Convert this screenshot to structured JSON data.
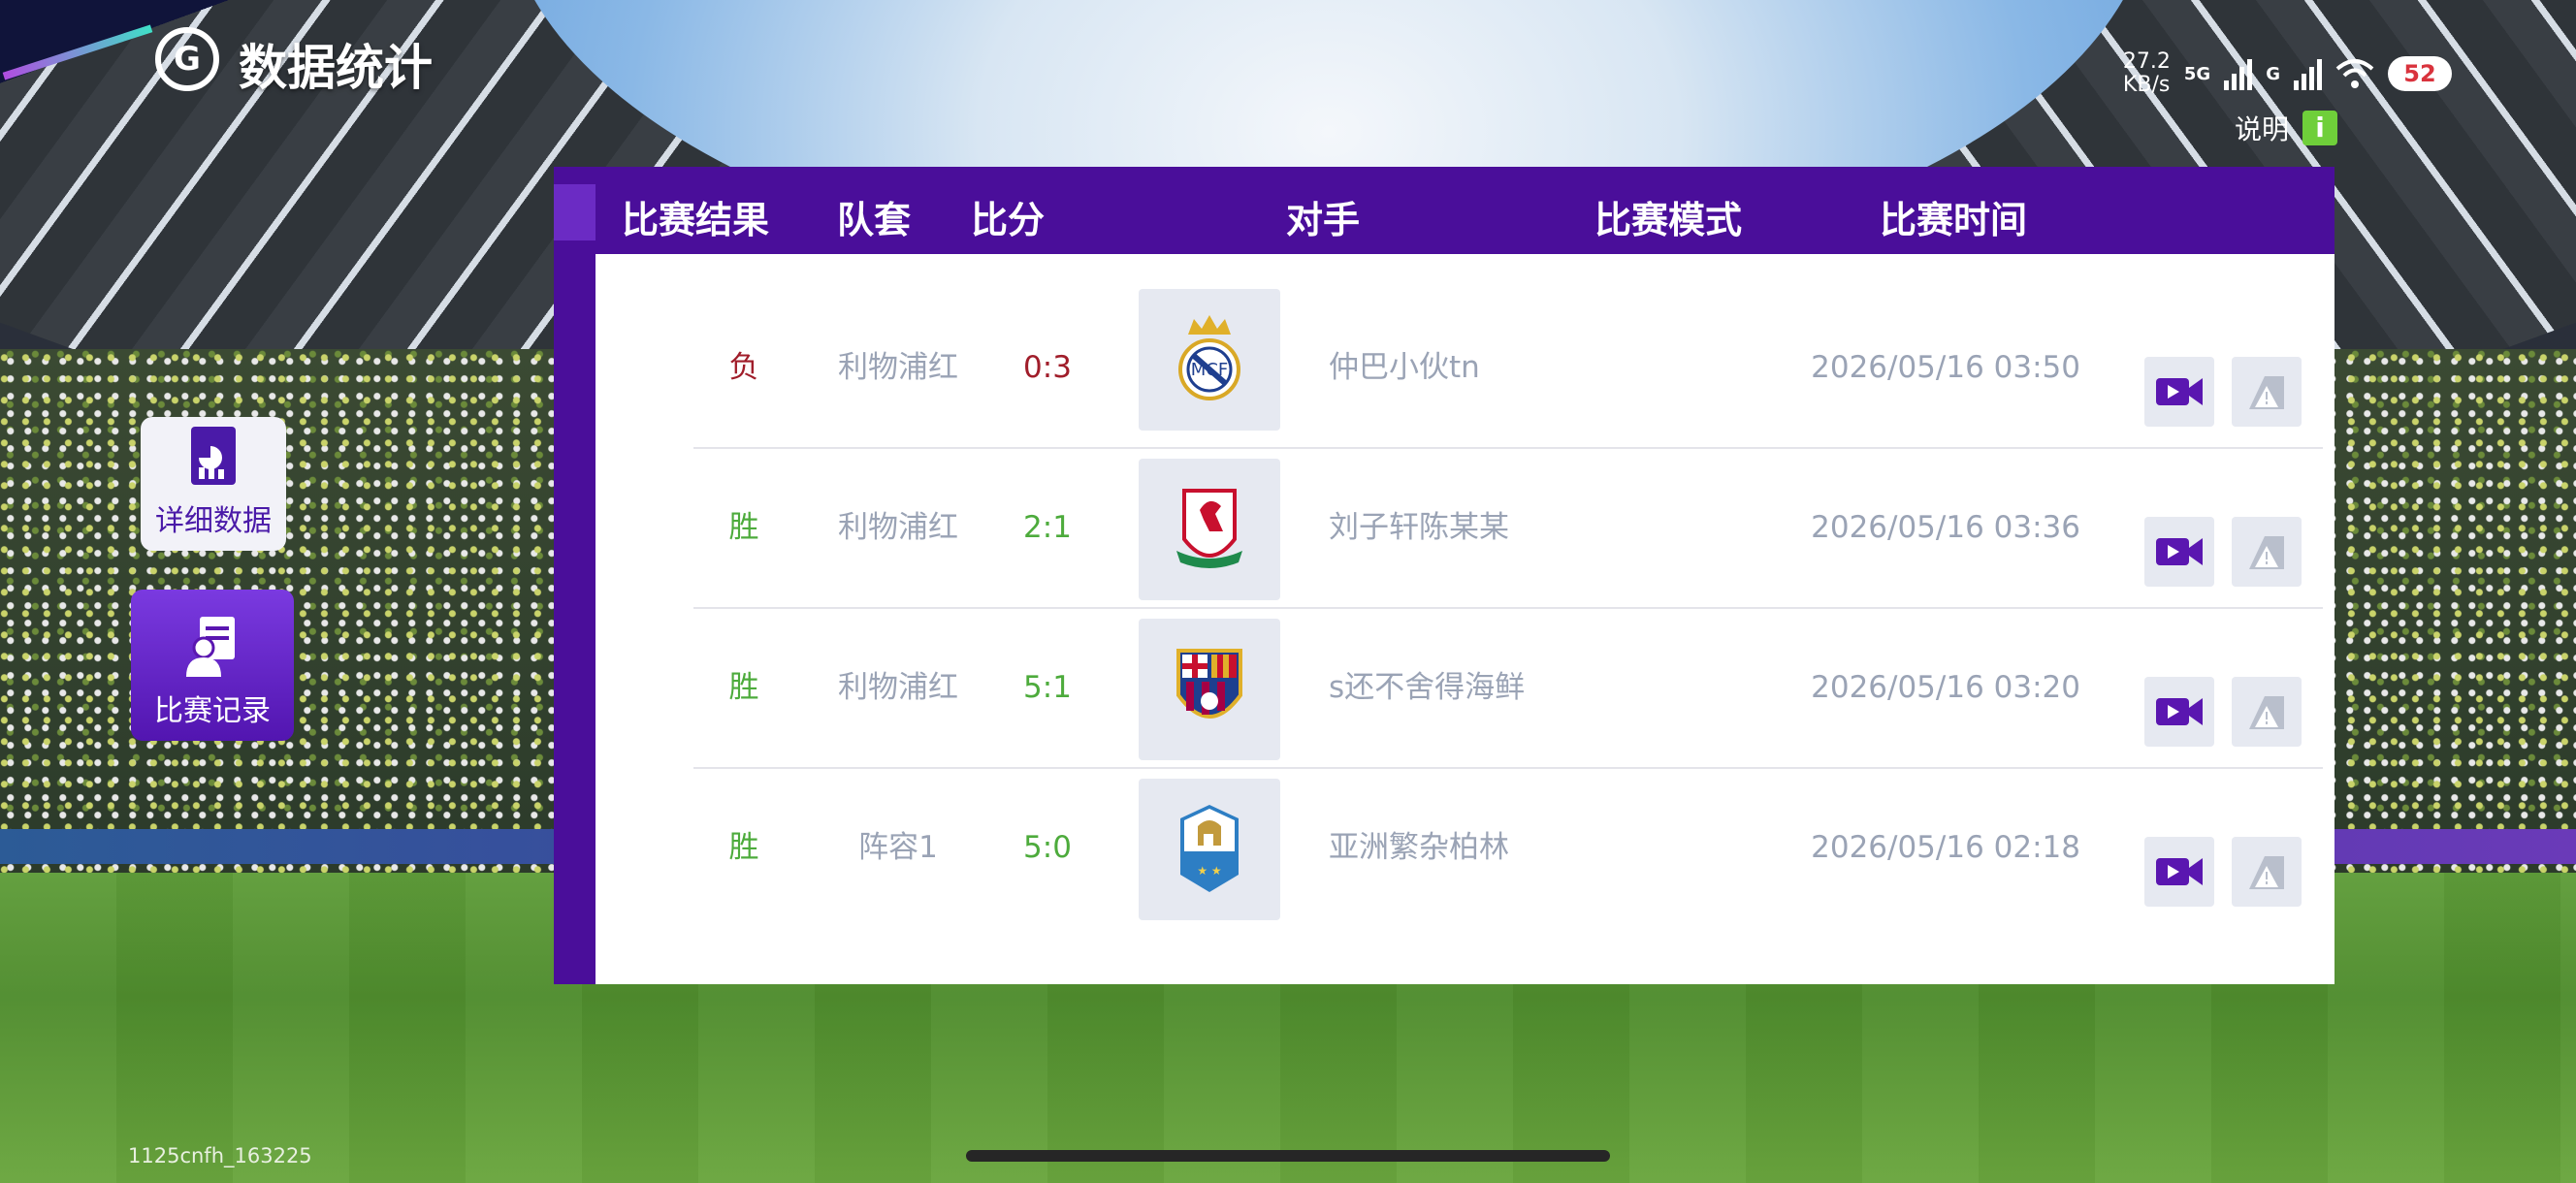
{
  "header": {
    "title": "数据统计",
    "logo_text": "G",
    "help_label": "说明",
    "help_icon": "i"
  },
  "status_bar": {
    "net_speed_value": "27.2",
    "net_speed_unit": "KB/s",
    "signal_1_label": "5G",
    "signal_2_label": "G",
    "battery": "52"
  },
  "sidebar": {
    "items": [
      {
        "label": "详细数据",
        "icon": "chart-document-icon",
        "active": false
      },
      {
        "label": "比赛记录",
        "icon": "person-clipboard-icon",
        "active": true
      }
    ]
  },
  "table": {
    "headers": [
      "比赛结果",
      "队套",
      "比分",
      "对手",
      "比赛模式",
      "比赛时间"
    ],
    "rows": [
      {
        "result": "负",
        "team": "利物浦红",
        "score": "0:3",
        "opponent": "仲巴小伙tn",
        "mode": "",
        "time": "2026/05/16 03:50",
        "crest": "crown-crest-icon"
      },
      {
        "result": "胜",
        "team": "利物浦红",
        "score": "2:1",
        "opponent": "刘子轩陈某某",
        "mode": "",
        "time": "2026/05/16 03:36",
        "crest": "liverbird-crest-icon"
      },
      {
        "result": "胜",
        "team": "利物浦红",
        "score": "5:1",
        "opponent": "s还不舍得海鲜",
        "mode": "",
        "time": "2026/05/16 03:20",
        "crest": "striped-crest-icon"
      },
      {
        "result": "胜",
        "team": "阵容1",
        "score": "5:0",
        "opponent": "亚洲繁杂柏林",
        "mode": "",
        "time": "2026/05/16 02:18",
        "crest": "helmet-crest-icon"
      }
    ]
  },
  "colors": {
    "win": "#4dab3c",
    "lose": "#a01d2a",
    "panel": "#4a0e9a",
    "accent": "#5a16b0"
  },
  "footer": {
    "user_id": "1125cnfh_163225"
  }
}
